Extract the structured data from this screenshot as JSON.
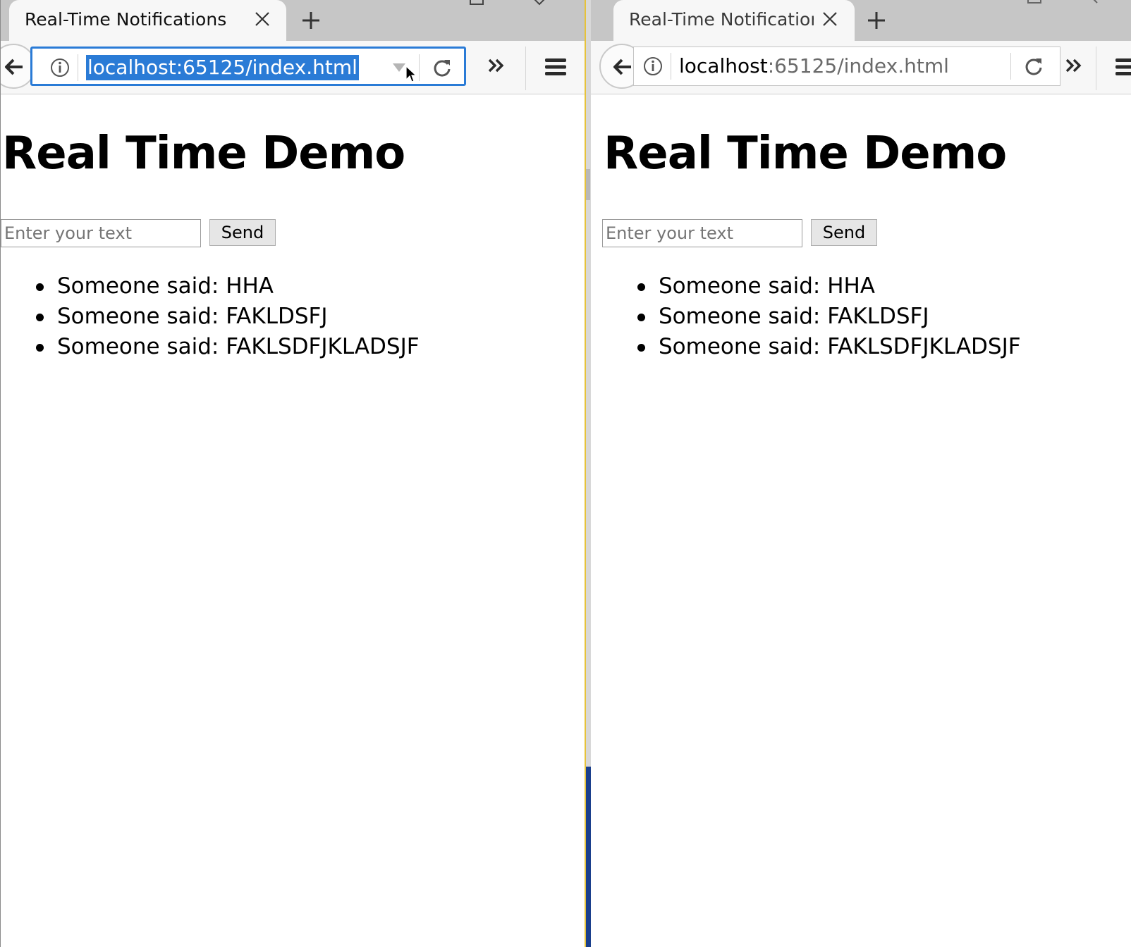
{
  "left_window": {
    "tab": {
      "title": "Real-Time Notifications",
      "close_icon": "close-icon",
      "new_tab_icon": "plus-icon"
    },
    "url": {
      "host": "localhost",
      "rest": ":65125/index.html",
      "selected": true
    },
    "page": {
      "title": "Real Time Demo",
      "input_placeholder": "Enter your text",
      "input_value": "",
      "send_label": "Send",
      "messages": [
        "Someone said: HHA",
        "Someone said: FAKLDSFJ",
        "Someone said: FAKLSDFJKLADSJF"
      ]
    }
  },
  "right_window": {
    "tab": {
      "title": "Real-Time Notifications",
      "close_icon": "close-icon",
      "new_tab_icon": "plus-icon"
    },
    "url": {
      "host": "localhost",
      "rest": ":65125/index.html",
      "selected": false
    },
    "page": {
      "title": "Real Time Demo",
      "input_placeholder": "Enter your text",
      "input_value": "",
      "send_label": "Send",
      "messages": [
        "Someone said: HHA",
        "Someone said: FAKLDSFJ",
        "Someone said: FAKLSDFJKLADSJF"
      ]
    }
  },
  "colors": {
    "tabstrip": "#c6c6c6",
    "toolbar": "#f7f7f7",
    "url_focus": "#2a7bd6",
    "divider_accent": "#e6c23a",
    "taskbar_blue": "#1a3f8c"
  }
}
